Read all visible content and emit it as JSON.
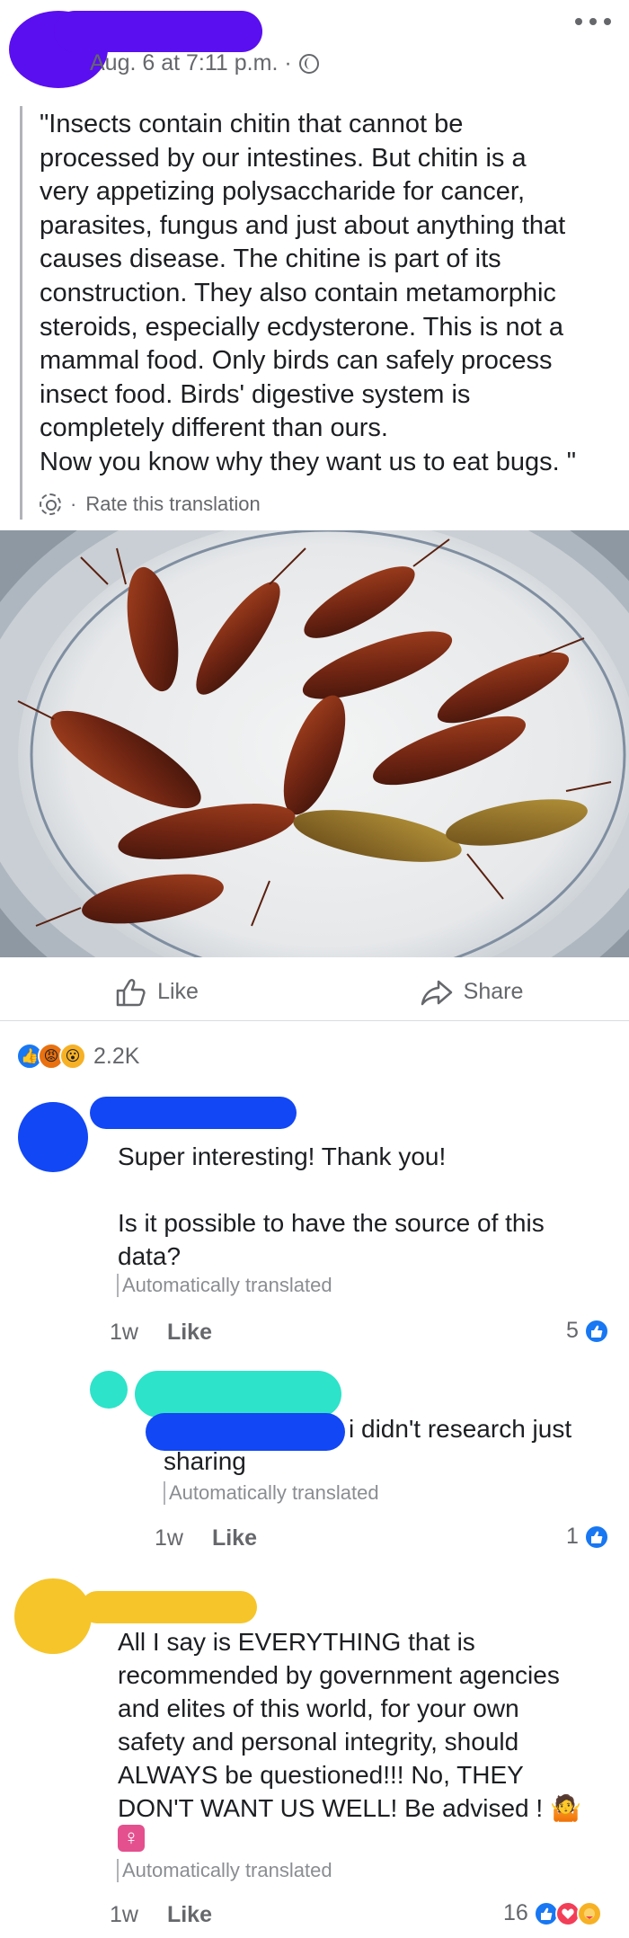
{
  "post": {
    "timestamp": "Aug. 6 at 7:11 p.m. ·",
    "quote": "\"Insects contain chitin that cannot be\nprocessed by our intestines. But chitin is a\nvery appetizing polysaccharide for cancer,\nparasites, fungus and just about anything that\ncauses disease. The chitine is part of its\nconstruction. They also contain metamorphic\nsteroids, especially ecdysterone. This is not a\nmammal food. Only birds can safely process\ninsect food. Birds' digestive system is\ncompletely different than ours.\nNow you know why they want us to eat bugs. \"",
    "rate_translation": "Rate this translation"
  },
  "actions": {
    "like": "Like",
    "share": "Share"
  },
  "reactions": {
    "count": "2.2K",
    "icons": [
      "like",
      "angry",
      "wow"
    ]
  },
  "comments": [
    {
      "text": "Super interesting! Thank you!\n\nIs it possible to have the source of this\ndata?",
      "translated": "Automatically translated",
      "time": "1w",
      "like": "Like",
      "count": "5"
    },
    {
      "text": "i didn't research just",
      "text2": "sharing",
      "translated": "Automatically translated",
      "time": "1w",
      "like": "Like",
      "count": "1"
    },
    {
      "text": "All I say is EVERYTHING that is\nrecommended by government agencies\nand elites of this world, for your own\nsafety and personal integrity, should\nALWAYS be questioned!!! No, THEY\nDON'T WANT US WELL! Be advised ! 🤷",
      "emoji_line": "♀",
      "translated": "Automatically translated",
      "time": "1w",
      "like": "Like",
      "count": "16"
    }
  ],
  "colors": {
    "redact_purple": "#5a0ff0",
    "redact_blue": "#1247f5",
    "redact_teal": "#2de3c9",
    "redact_yellow": "#f6c52a",
    "like_blue": "#1877f2"
  }
}
